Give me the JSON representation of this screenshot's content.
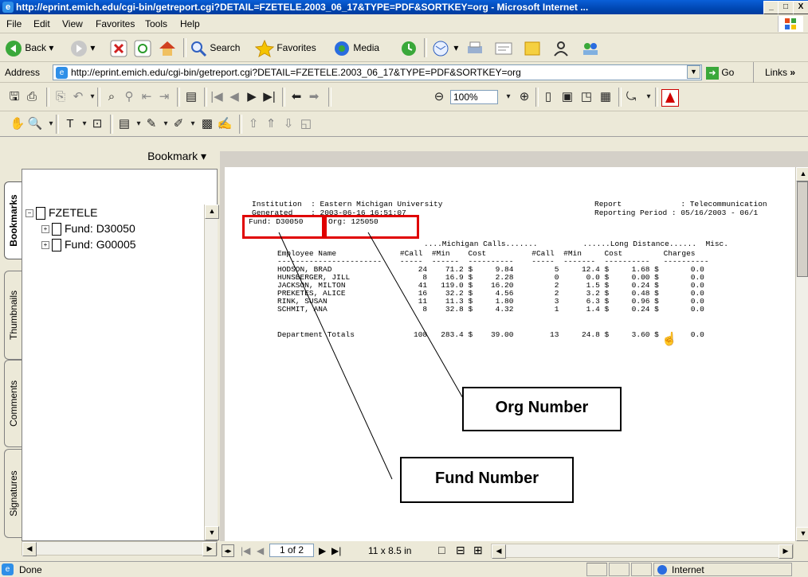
{
  "window": {
    "title": "http://eprint.emich.edu/cgi-bin/getreport.cgi?DETAIL=FZETELE.2003_06_17&TYPE=PDF&SORTKEY=org - Microsoft Internet ...",
    "minimize": "_",
    "maximize": "□",
    "close": "X"
  },
  "menu": [
    "File",
    "Edit",
    "View",
    "Favorites",
    "Tools",
    "Help"
  ],
  "toolbar": {
    "back": "Back",
    "search": "Search",
    "favorites": "Favorites",
    "media": "Media"
  },
  "address": {
    "label": "Address",
    "url": "http://eprint.emich.edu/cgi-bin/getreport.cgi?DETAIL=FZETELE.2003_06_17&TYPE=PDF&SORTKEY=org",
    "go": "Go",
    "links": "Links"
  },
  "acrobat": {
    "zoom": "100%"
  },
  "sidetabs": [
    "Bookmarks",
    "Thumbnails",
    "Comments",
    "Signatures"
  ],
  "bookmarks": {
    "header": "Bookmark ▾",
    "root": "FZETELE",
    "children": [
      "Fund: D30050",
      "Fund: G00005"
    ]
  },
  "report": {
    "line1_left": "Institution  : Eastern Michigan University",
    "line1_right": "Report             : Telecommunication",
    "line2_left": "Generated    : 2003-06-16 16:51:07",
    "line2_right": "Reporting Period : 05/16/2003 - 06/1",
    "fund": "Fund: D30050",
    "org": "Org: 125050",
    "group_header": "....Michigan Calls.......          ......Long Distance......  Misc.",
    "col_header": "Employee Name              #Call  #Min    Cost          #Call  #Min     Cost         Charges",
    "col_rule": "-----------------------    -----  ------  ----------    -----  -------  ----------   ----------",
    "rows": [
      "HODSON, BRAD                   24    71.2 $     9.84         5     12.4 $     1.68 $       0.0",
      "HUNSBERGER, JILL                8    16.9 $     2.28         0      0.0 $     0.00 $       0.0",
      "JACKSON, MILTON                41   119.0 $    16.20         2      1.5 $     0.24 $       0.0",
      "PREKETES, ALICE                16    32.2 $     4.56         2      3.2 $     0.48 $       0.0",
      "RINK, SUSAN                    11    11.3 $     1.80         3      6.3 $     0.96 $       0.0",
      "SCHMIT, ANA                     8    32.8 $     4.32         1      1.4 $     0.24 $       0.0"
    ],
    "totals": "Department Totals             108   283.4 $    39.00        13     24.8 $     3.60 $       0.0"
  },
  "callouts": {
    "org": "Org Number",
    "fund": "Fund Number"
  },
  "nav": {
    "page": "1 of 2",
    "size": "11 x 8.5 in"
  },
  "status": {
    "left": "Done",
    "zone": "Internet"
  }
}
